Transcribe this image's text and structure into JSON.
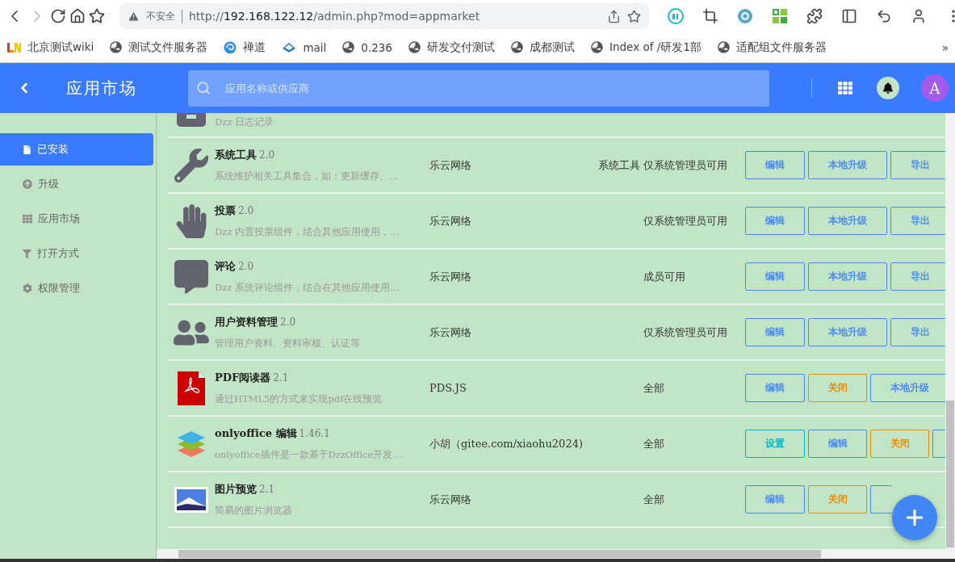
{
  "browser": {
    "nav": [
      {
        "kind": "back",
        "disabled": false
      },
      {
        "kind": "forward",
        "disabled": true
      },
      {
        "kind": "reload",
        "disabled": false
      },
      {
        "kind": "home",
        "disabled": false
      },
      {
        "kind": "star",
        "disabled": false
      }
    ],
    "security": "不安全",
    "url": {
      "scheme": "http://",
      "host": "192.168.122.12",
      "path": "/admin.php?mod=appmarket"
    },
    "bookmarks": [
      {
        "kind": "wiki",
        "label": "北京测试wiki"
      },
      {
        "kind": "globe",
        "label": "测试文件服务器"
      },
      {
        "kind": "zentao",
        "label": "禅道"
      },
      {
        "kind": "mail",
        "label": "mail"
      },
      {
        "kind": "globe",
        "label": "0.236"
      },
      {
        "kind": "globe",
        "label": "研发交付测试"
      },
      {
        "kind": "globe",
        "label": "成都测试"
      },
      {
        "kind": "globe",
        "label": "Index of /研发1部"
      },
      {
        "kind": "globe",
        "label": "适配组文件服务器"
      }
    ],
    "more": "»"
  },
  "header": {
    "title": "应用市场",
    "search": {
      "placeholder": "应用名称或供应商"
    },
    "avatar": "A"
  },
  "sidebar": {
    "items": [
      {
        "label": "已安装",
        "selected": true
      },
      {
        "label": "升级",
        "selected": false
      },
      {
        "label": "应用市场",
        "selected": false
      },
      {
        "label": "打开方式",
        "selected": false
      },
      {
        "label": "权限管理",
        "selected": false
      }
    ]
  },
  "apps": [
    {
      "kind": "clipped",
      "description": "Dzz 日志记录"
    },
    {
      "kind": "full",
      "name": "系统工具",
      "version": "2.0",
      "description": "系统维护相关工具集合，如：更新缓存、…",
      "vendor": "乐云网络",
      "category": "系统工具",
      "permission": "仅系统管理员可用",
      "buttons": [
        {
          "label": "编辑",
          "kind": "primary"
        },
        {
          "label": "本地升级",
          "kind": "primary"
        },
        {
          "label": "导出",
          "kind": "primary"
        }
      ]
    },
    {
      "kind": "full",
      "name": "投票",
      "version": "2.0",
      "description": "Dzz 内置投票组件，结合其他应用使用，…",
      "vendor": "乐云网络",
      "permission": "仅系统管理员可用",
      "buttons": [
        {
          "label": "编辑",
          "kind": "primary"
        },
        {
          "label": "本地升级",
          "kind": "primary"
        },
        {
          "label": "导出",
          "kind": "primary"
        }
      ]
    },
    {
      "kind": "full",
      "name": "评论",
      "version": "2.0",
      "description": "Dzz 系统评论组件，结合在其他应用使用…",
      "vendor": "乐云网络",
      "permission": "成员可用",
      "buttons": [
        {
          "label": "编辑",
          "kind": "primary"
        },
        {
          "label": "本地升级",
          "kind": "primary"
        },
        {
          "label": "导出",
          "kind": "primary"
        }
      ]
    },
    {
      "kind": "full",
      "name": "用户资料管理",
      "version": "2.0",
      "description": "管理用户资料、资料审核、认证等",
      "vendor": "乐云网络",
      "permission": "仅系统管理员可用",
      "buttons": [
        {
          "label": "编辑",
          "kind": "primary"
        },
        {
          "label": "本地升级",
          "kind": "primary"
        },
        {
          "label": "导出",
          "kind": "primary"
        }
      ]
    },
    {
      "kind": "full",
      "name": "PDF阅读器",
      "version": "2.1",
      "description": "通过HTML5的方式来实现pdf在线预览",
      "vendor": "PDS.JS",
      "permission": "全部",
      "buttons": [
        {
          "label": "编辑",
          "kind": "primary"
        },
        {
          "label": "关闭",
          "kind": "warning"
        },
        {
          "label": "本地升级",
          "kind": "primary"
        }
      ]
    },
    {
      "kind": "full",
      "name": "onlyoffice 编辑",
      "version": "1.46.1",
      "description": "onlyoffice插件是一款基于DzzOffice开发…",
      "vendor": "小胡（gitee.com/xiaohu2024)",
      "permission": "全部",
      "buttons": [
        {
          "label": "设置",
          "kind": "info"
        },
        {
          "label": "编辑",
          "kind": "primary"
        },
        {
          "label": "关闭",
          "kind": "warning"
        },
        {
          "kind": "primary"
        }
      ]
    },
    {
      "kind": "full",
      "name": "图片预览",
      "version": "2.1",
      "description": "简易的图片浏览器",
      "vendor": "乐云网络",
      "permission": "全部",
      "buttons": [
        {
          "label": "编辑",
          "kind": "primary"
        },
        {
          "label": "关闭",
          "kind": "warning"
        },
        {
          "kind": "primary"
        }
      ]
    }
  ]
}
